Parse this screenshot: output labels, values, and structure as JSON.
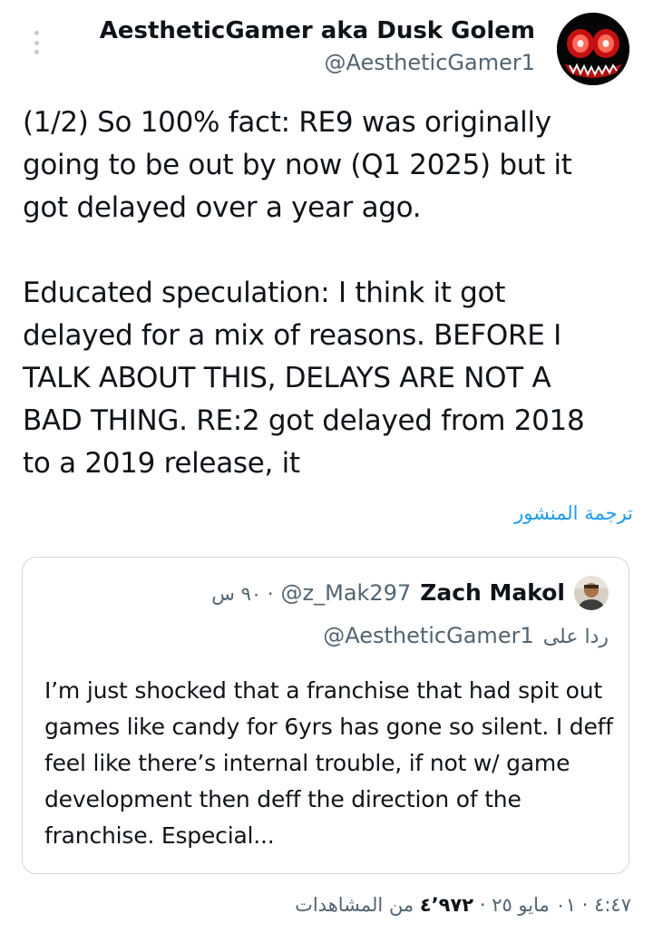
{
  "author": {
    "name": "AestheticGamer aka Dusk Golem",
    "handle": "@AestheticGamer1"
  },
  "tweet": {
    "text": "(1/2) So 100% fact: RE9 was originally\ngoing to be out by now (Q1 2025) but it\ngot delayed over a year ago.\n\nEducated speculation: I think it got\ndelayed for a mix of reasons. BEFORE I\nTALK ABOUT THIS, DELAYS ARE NOT A\nBAD THING. RE:2 got delayed from 2018\nto a 2019 release, it",
    "translate_label": "ترجمة المنشور"
  },
  "quoted": {
    "name": "Zach Makol",
    "handle": "@z_Mak297",
    "time": "· ٩٠ س",
    "reply_label": "ردا على",
    "reply_to": "@AestheticGamer1",
    "text": "I’m just shocked that a franchise that had spit out games like candy for 6yrs has gone so silent. I deff feel like there’s internal trouble, if not w/ game development then deff the direction of the franchise. Especial..."
  },
  "meta": {
    "time": "٤:٤٧",
    "date": "٠١ مايو ٢٥",
    "views_count": "٤٬٩٧٢",
    "views_label": "من المشاهدات",
    "separator": "·"
  },
  "icons": {
    "more": "more-vertical-icon",
    "author_avatar": "demon-face-avatar",
    "quoted_avatar": "person-avatar"
  },
  "colors": {
    "text_primary": "#0f1419",
    "text_secondary": "#536471",
    "link": "#1d9bf0",
    "border": "#cfd9de"
  }
}
